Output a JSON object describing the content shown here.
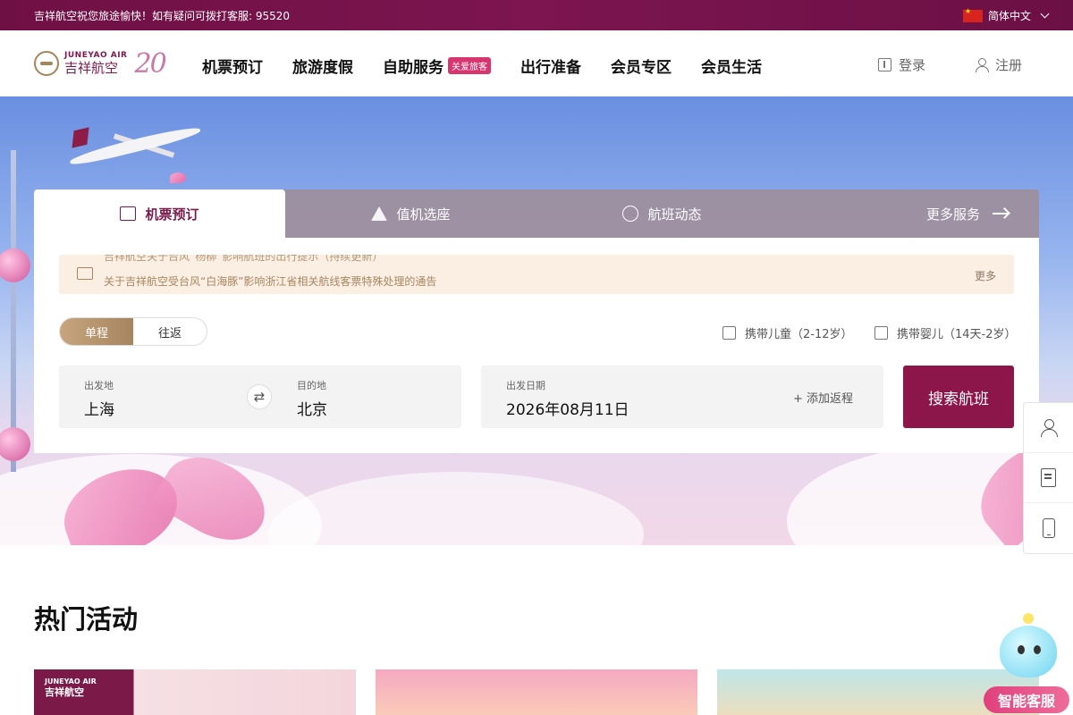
{
  "topbar": {
    "message": "吉祥航空祝您旅途愉快！如有疑问可拨打客服: 95520",
    "language": "简体中文"
  },
  "brand": {
    "name_en": "JUNEYAO AIR",
    "name_cn": "吉祥航空",
    "anniversary": "20"
  },
  "nav": {
    "items": [
      {
        "label": "机票预订"
      },
      {
        "label": "旅游度假"
      },
      {
        "label": "自助服务",
        "badge": "关爱旅客"
      },
      {
        "label": "出行准备"
      },
      {
        "label": "会员专区"
      },
      {
        "label": "会员生活"
      }
    ],
    "login": "登录",
    "register": "注册"
  },
  "booking": {
    "tabs": [
      {
        "label": "机票预订",
        "icon": "ticket-icon"
      },
      {
        "label": "值机选座",
        "icon": "seat-icon"
      },
      {
        "label": "航班动态",
        "icon": "flight-status-icon"
      }
    ],
    "more_services": "更多服务",
    "notices": [
      "吉祥航空关于台风“杨柳”影响航班的出行提示（持续更新）",
      "关于吉祥航空受台风“白海豚”影响浙江省相关航线客票特殊处理的通告"
    ],
    "notice_more": "更多",
    "trip_types": [
      "单程",
      "往返"
    ],
    "trip_selected": "单程",
    "options": [
      "携带儿童（2-12岁）",
      "携带婴儿（14天-2岁）"
    ],
    "origin_label": "出发地",
    "origin": "上海",
    "dest_label": "目的地",
    "dest": "北京",
    "date_label": "出发日期",
    "date": "2026年08月11日",
    "add_return": "添加返程",
    "search": "搜索航班"
  },
  "hot": {
    "title": "热门活动",
    "promo1_logo_en": "JUNEYAO AIR",
    "promo1_logo_cn": "吉祥航空"
  },
  "assistant": {
    "label": "智能客服"
  },
  "colors": {
    "brand": "#7a1a4c",
    "search_button": "#8c1549",
    "gold": "#a58560"
  }
}
